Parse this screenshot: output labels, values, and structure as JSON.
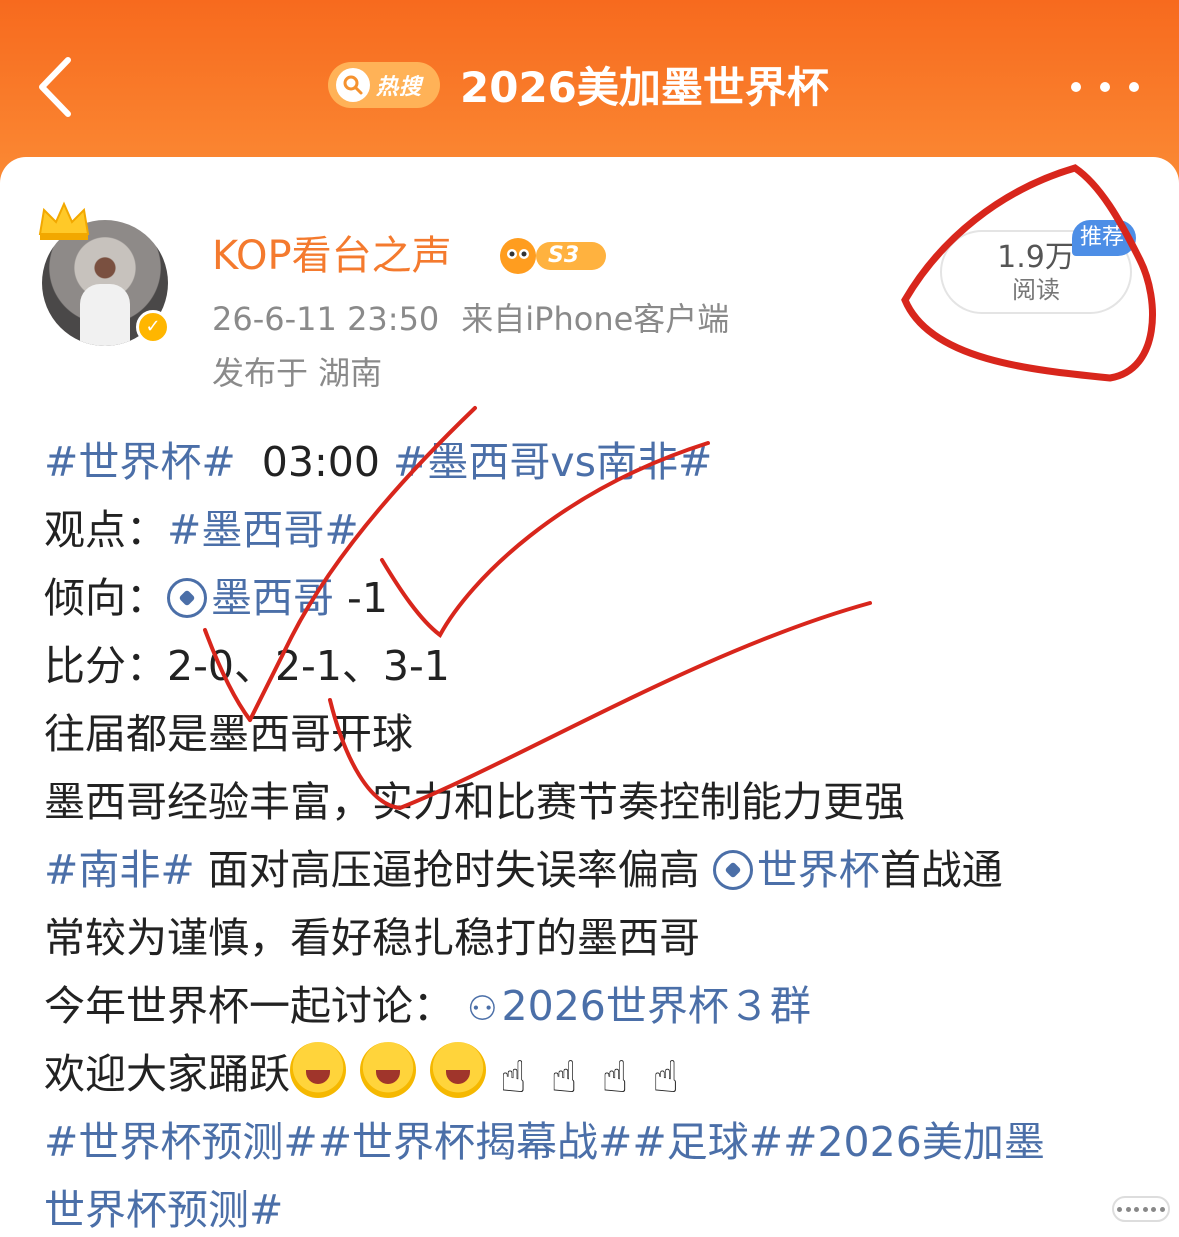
{
  "header": {
    "hot_label": "热搜",
    "title": "2026美加墨世界杯"
  },
  "post": {
    "username": "KOP看台之声",
    "level": "S3",
    "timestamp": "26-6-11 23:50",
    "source": "来自iPhone客户端",
    "location": "发布于 湖南",
    "read_count": "1.9万",
    "read_label": "阅读",
    "recommend_tag": "推荐"
  },
  "content": {
    "l1_tag1": "#世界杯#",
    "l1_time": "03:00",
    "l1_tag2": "#墨西哥vs南非#",
    "l2_label": "观点：",
    "l2_tag": "#墨西哥#",
    "l3_label": "倾向：",
    "l3_link": "墨西哥",
    "l3_value": "-1",
    "l4_label": "比分：",
    "l4_scores": "2-0、2-1、3-1",
    "l5": "往届都是墨西哥开球",
    "l6": "墨西哥经验丰富，实力和比赛节奏控制能力更强",
    "l7_tag": "#南非#",
    "l7_text": "面对高压逼抢时失误率偏高",
    "l7_link": "世界杯",
    "l7_tail": "首战通",
    "l8": "常较为谨慎，看好稳扎稳打的墨西哥",
    "l9_text": "今年世界杯一起讨论：",
    "l9_group": "2026世界杯３群",
    "l10_text": "欢迎大家踊跃",
    "l11_tags": "#世界杯预测##世界杯揭幕战##足球##2026美加墨",
    "l12_tags": "世界杯预测#"
  },
  "colors": {
    "header_orange": "#f76a1e",
    "link_blue": "#4b6fa8",
    "username_orange": "#f47a2e",
    "annotation_red": "#d8261c"
  },
  "icons": [
    "back-arrow-icon",
    "search-icon",
    "more-icon",
    "crown-icon",
    "verified-icon",
    "football-icon",
    "group-icon",
    "cheer-emoji-icon",
    "pointing-up-icon"
  ]
}
